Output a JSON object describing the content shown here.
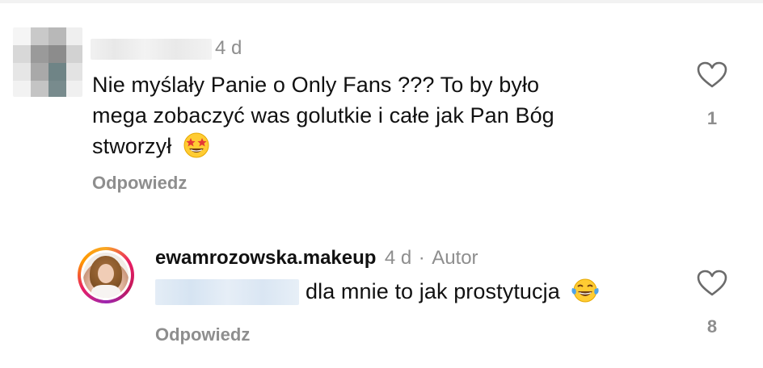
{
  "comment": {
    "timestamp": "4 d",
    "text": "Nie myślały Panie o Only Fans ??? To by było mega zobaczyć was golutkie i całe jak Pan Bóg stworzył",
    "line1": "Nie myślały Panie o Only Fans ??? To by było",
    "line2": "mega zobaczyć was golutkie i całe jak Pan Bóg",
    "line3": "stworzył",
    "emoji": "star-struck-emoji",
    "reply_label": "Odpowiedz",
    "like_count": "1"
  },
  "reply": {
    "username": "ewamrozowska.makeup",
    "timestamp": "4 d",
    "separator": "·",
    "author_badge": "Autor",
    "text": "dla mnie to jak prostytucja",
    "emoji": "tears-of-joy-emoji",
    "reply_label": "Odpowiedz",
    "like_count": "8"
  },
  "colors": {
    "text": "#111111",
    "muted": "#8e8e8e",
    "ring_start": "#f9a825",
    "ring_end": "#e91e63"
  }
}
